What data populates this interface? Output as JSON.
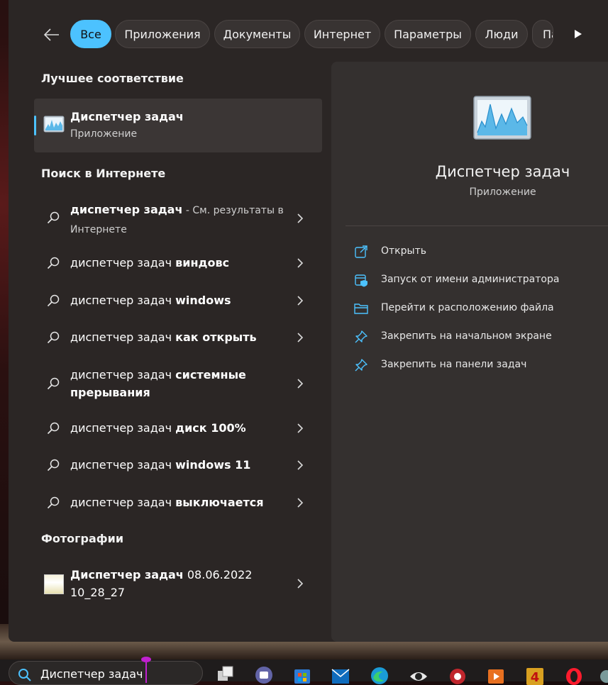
{
  "filters": {
    "back_icon": "arrow-left-icon",
    "chips": [
      {
        "label": "Все",
        "active": true
      },
      {
        "label": "Приложения",
        "active": false
      },
      {
        "label": "Документы",
        "active": false
      },
      {
        "label": "Интернет",
        "active": false
      },
      {
        "label": "Параметры",
        "active": false
      },
      {
        "label": "Люди",
        "active": false
      },
      {
        "label": "Па",
        "active": false
      }
    ],
    "more_icon": "play-right-icon"
  },
  "best_match": {
    "title": "Лучшее соответствие",
    "app_name": "Диспетчер задач",
    "app_type": "Приложение"
  },
  "web": {
    "title": "Поиск в Интернете",
    "items": [
      {
        "prefix": "диспетчер задач",
        "bold": "",
        "suffix": " - См. результаты в Интернете"
      },
      {
        "prefix": "диспетчер задач ",
        "bold": "виндовс",
        "suffix": ""
      },
      {
        "prefix": "диспетчер задач ",
        "bold": "windows",
        "suffix": ""
      },
      {
        "prefix": "диспетчер задач ",
        "bold": "как открыть",
        "suffix": ""
      },
      {
        "prefix": "диспетчер задач ",
        "bold": "системные прерывания",
        "suffix": ""
      },
      {
        "prefix": "диспетчер задач ",
        "bold": "диск 100%",
        "suffix": ""
      },
      {
        "prefix": "диспетчер задач ",
        "bold": "windows 11",
        "suffix": ""
      },
      {
        "prefix": "диспетчер задач ",
        "bold": "выключается",
        "suffix": ""
      }
    ]
  },
  "photos": {
    "title": "Фотографии",
    "item": {
      "bold": "Диспетчер задач",
      "rest": " 08.06.2022 10_28_27"
    }
  },
  "details": {
    "app_name": "Диспетчер задач",
    "app_type": "Приложение",
    "actions": [
      {
        "label": "Открыть",
        "icon": "open-external-icon"
      },
      {
        "label": "Запуск от имени администратора",
        "icon": "admin-shield-icon"
      },
      {
        "label": "Перейти к расположению файла",
        "icon": "folder-icon"
      },
      {
        "label": "Закрепить на начальном экране",
        "icon": "pin-icon"
      },
      {
        "label": "Закрепить на панели задач",
        "icon": "pin-icon"
      }
    ]
  },
  "taskbar": {
    "search_value": "Диспетчер задач",
    "apps": [
      "task-view-icon",
      "teams-icon",
      "store-icon",
      "mail-icon",
      "edge-icon",
      "app-eye-icon",
      "app-red-icon",
      "media-icon",
      "app-4-icon",
      "opera-icon",
      "app-extra-icon"
    ]
  },
  "colors": {
    "accent": "#4cc2ff",
    "panel": "#2b2625",
    "detail_panel": "#34302f"
  }
}
